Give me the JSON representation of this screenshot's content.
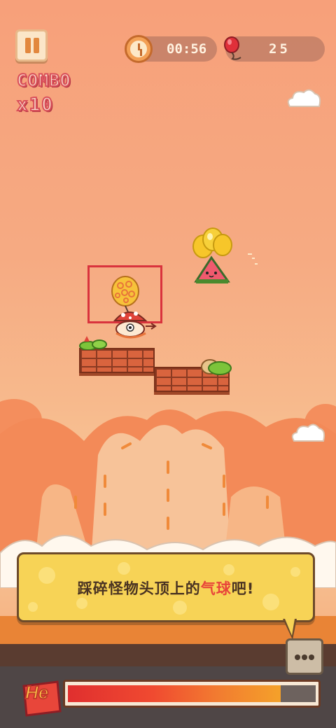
{
  "hud": {
    "combo_label": "COMBO",
    "combo_count": "x10",
    "timer": "00:56",
    "balloons": "25"
  },
  "tip": {
    "text_before": "踩碎怪物头顶上的",
    "text_highlight": "气球",
    "text_after": "吧!"
  },
  "badge": {
    "label": "He"
  },
  "progress": {
    "fraction": 0.86
  },
  "icons": {
    "pause": "pause-icon",
    "timer": "clock-icon",
    "balloons": "red-balloon-icon",
    "more": "more-dots-icon"
  },
  "colors": {
    "combo": "#d94f5a",
    "tip_highlight": "#e8443a",
    "tip_bubble": "#f7d356",
    "progress_fill": "#f04a30"
  }
}
